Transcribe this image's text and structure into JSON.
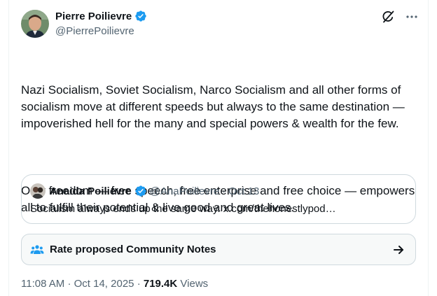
{
  "author": {
    "display_name": "Pierre Poilievre",
    "handle": "@PierrePoilievre"
  },
  "tweet": {
    "paragraphs": [
      "Nazi Socialism, Soviet Socialism, Narco Socialism and all other forms of socialism move at different speeds but always to the same destination — impoverished hell for the many and special powers & wealth for the few.",
      "Only freedom — free speech, free enterprise and free choice — empowers all to fulfill their potential & live good and great lives."
    ]
  },
  "quote": {
    "display_name": "Anaida Poilievre",
    "handle": "@AnaPoilievre",
    "separator": "·",
    "date": "Oct 13",
    "text": "Socialism always ends up the same way. x.com/thehonestlypod…"
  },
  "community_notes": {
    "label": "Rate proposed Community Notes"
  },
  "meta": {
    "time": "11:08 AM",
    "separator": "·",
    "date": "Oct 14, 2025",
    "views_count": "719.4K",
    "views_label": "Views"
  },
  "icons": {
    "verified": "verified-badge-icon",
    "grok": "grok-icon",
    "more": "more-icon",
    "community_notes": "community-notes-icon",
    "arrow": "arrow-right-icon"
  },
  "colors": {
    "verified_blue": "#1d9bf0",
    "text_primary": "#0f1419",
    "text_secondary": "#536471",
    "border": "#cfd9de"
  }
}
